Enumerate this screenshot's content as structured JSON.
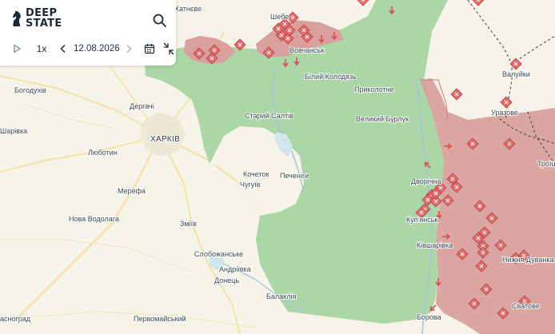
{
  "app": {
    "logo_line1": "DEEP",
    "logo_line2": "STATE"
  },
  "player": {
    "speed": "1x",
    "date": "12.08.2026"
  },
  "icons": {
    "logo": "knight-chess-icon",
    "search": "search-icon",
    "play": "play-icon",
    "prev": "chevron-left-icon",
    "next": "chevron-right-icon",
    "calendar": "calendar-icon",
    "collapse": "collapse-arrows-icon"
  },
  "colors": {
    "liberated": "#a7d4a2",
    "occupied": "#d9a09d",
    "contested": "#c98787",
    "marker": "#e36a6a",
    "background": "#f6f3e8",
    "water": "#cfe6ee",
    "border": "#3a3a3a"
  },
  "legend_markers": {
    "attack_marker": "diamond-cross-icon",
    "arrow_marker": "attack-arrow-icon"
  },
  "places": {
    "khatneve": "Хатнєве",
    "shebekino": "Шебе",
    "vovchansk": "Вовчанськ",
    "bilyi_kolodiaz": "Білий Колодязь",
    "prykolotne": "Приколотне",
    "starui_saltiv": "Старий Салтів",
    "velykyi_burluk": "Великий Бурлук",
    "bohodukhiv": "Богодухів",
    "derhachi": "Дергачі",
    "sharivka": "Шарівка",
    "kharkiv": "ХАРКІВ",
    "liubotyn": "Люботин",
    "kochetok": "Кочеток",
    "chuhuiv": "Чугуїв",
    "pechenihy": "Печеніги",
    "dvorichna": "Дворічна",
    "kupiansk": "Куп'янськ",
    "merefa": "Мерефа",
    "nova_vodolaha": "Нова Водолага",
    "zmiiv": "Зміїв",
    "kivsharivka": "Ківшарівка",
    "slobozhanske": "Слобожанське",
    "andriivka": "Андріївка",
    "donets": "Донець",
    "balakliia": "Балаклія",
    "pervomaiskyi": "Первомайський",
    "krasnohrad": "асноград",
    "borova": "Борова",
    "valuiky": "Валуйки",
    "urazove": "Уразове",
    "troitske": "Троїц",
    "nyzhnia_duvanka": "Нижня Дуванка",
    "svatove": "Сватове"
  }
}
